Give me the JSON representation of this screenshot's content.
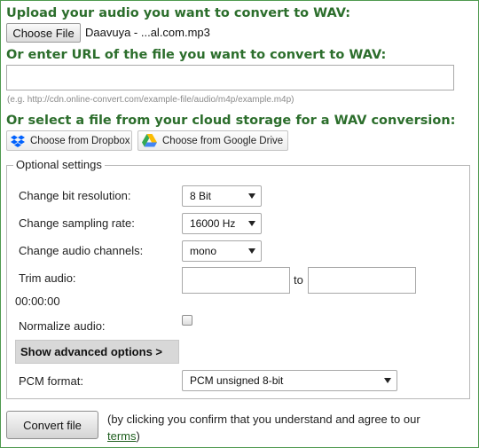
{
  "upload": {
    "heading": "Upload your audio you want to convert to WAV:",
    "choose_file_label": "Choose File",
    "file_name": "Daavuya - ...al.com.mp3"
  },
  "url": {
    "heading": "Or enter URL of the file you want to convert to WAV:",
    "value": "",
    "hint": "(e.g. http://cdn.online-convert.com/example-file/audio/m4p/example.m4p)"
  },
  "cloud": {
    "heading": "Or select a file from your cloud storage for a WAV conversion:",
    "dropbox_label": "Choose from Dropbox",
    "gdrive_label": "Choose from Google Drive"
  },
  "optional": {
    "legend": "Optional settings",
    "bit_resolution": {
      "label": "Change bit resolution:",
      "value": "8 Bit"
    },
    "sampling_rate": {
      "label": "Change sampling rate:",
      "value": "16000 Hz"
    },
    "audio_channels": {
      "label": "Change audio channels:",
      "value": "mono"
    },
    "trim": {
      "label": "Trim audio:",
      "time": "00:00:00",
      "to_label": "to",
      "from_value": "",
      "to_value": ""
    },
    "normalize": {
      "label": "Normalize audio:",
      "checked": false
    },
    "advanced_label": "Show advanced options >",
    "pcm_format": {
      "label": "PCM format:",
      "value": "PCM unsigned 8-bit"
    }
  },
  "convert": {
    "button_label": "Convert file",
    "agree_text": "(by clicking you confirm that you understand and agree to our ",
    "terms_label": "terms",
    "agree_close": ")"
  },
  "colors": {
    "heading": "#2c6e2c",
    "frame": "#4f9a4f",
    "dropbox": "#0061fe"
  },
  "icons": {
    "dropbox": "dropbox-icon",
    "gdrive": "google-drive-icon"
  }
}
